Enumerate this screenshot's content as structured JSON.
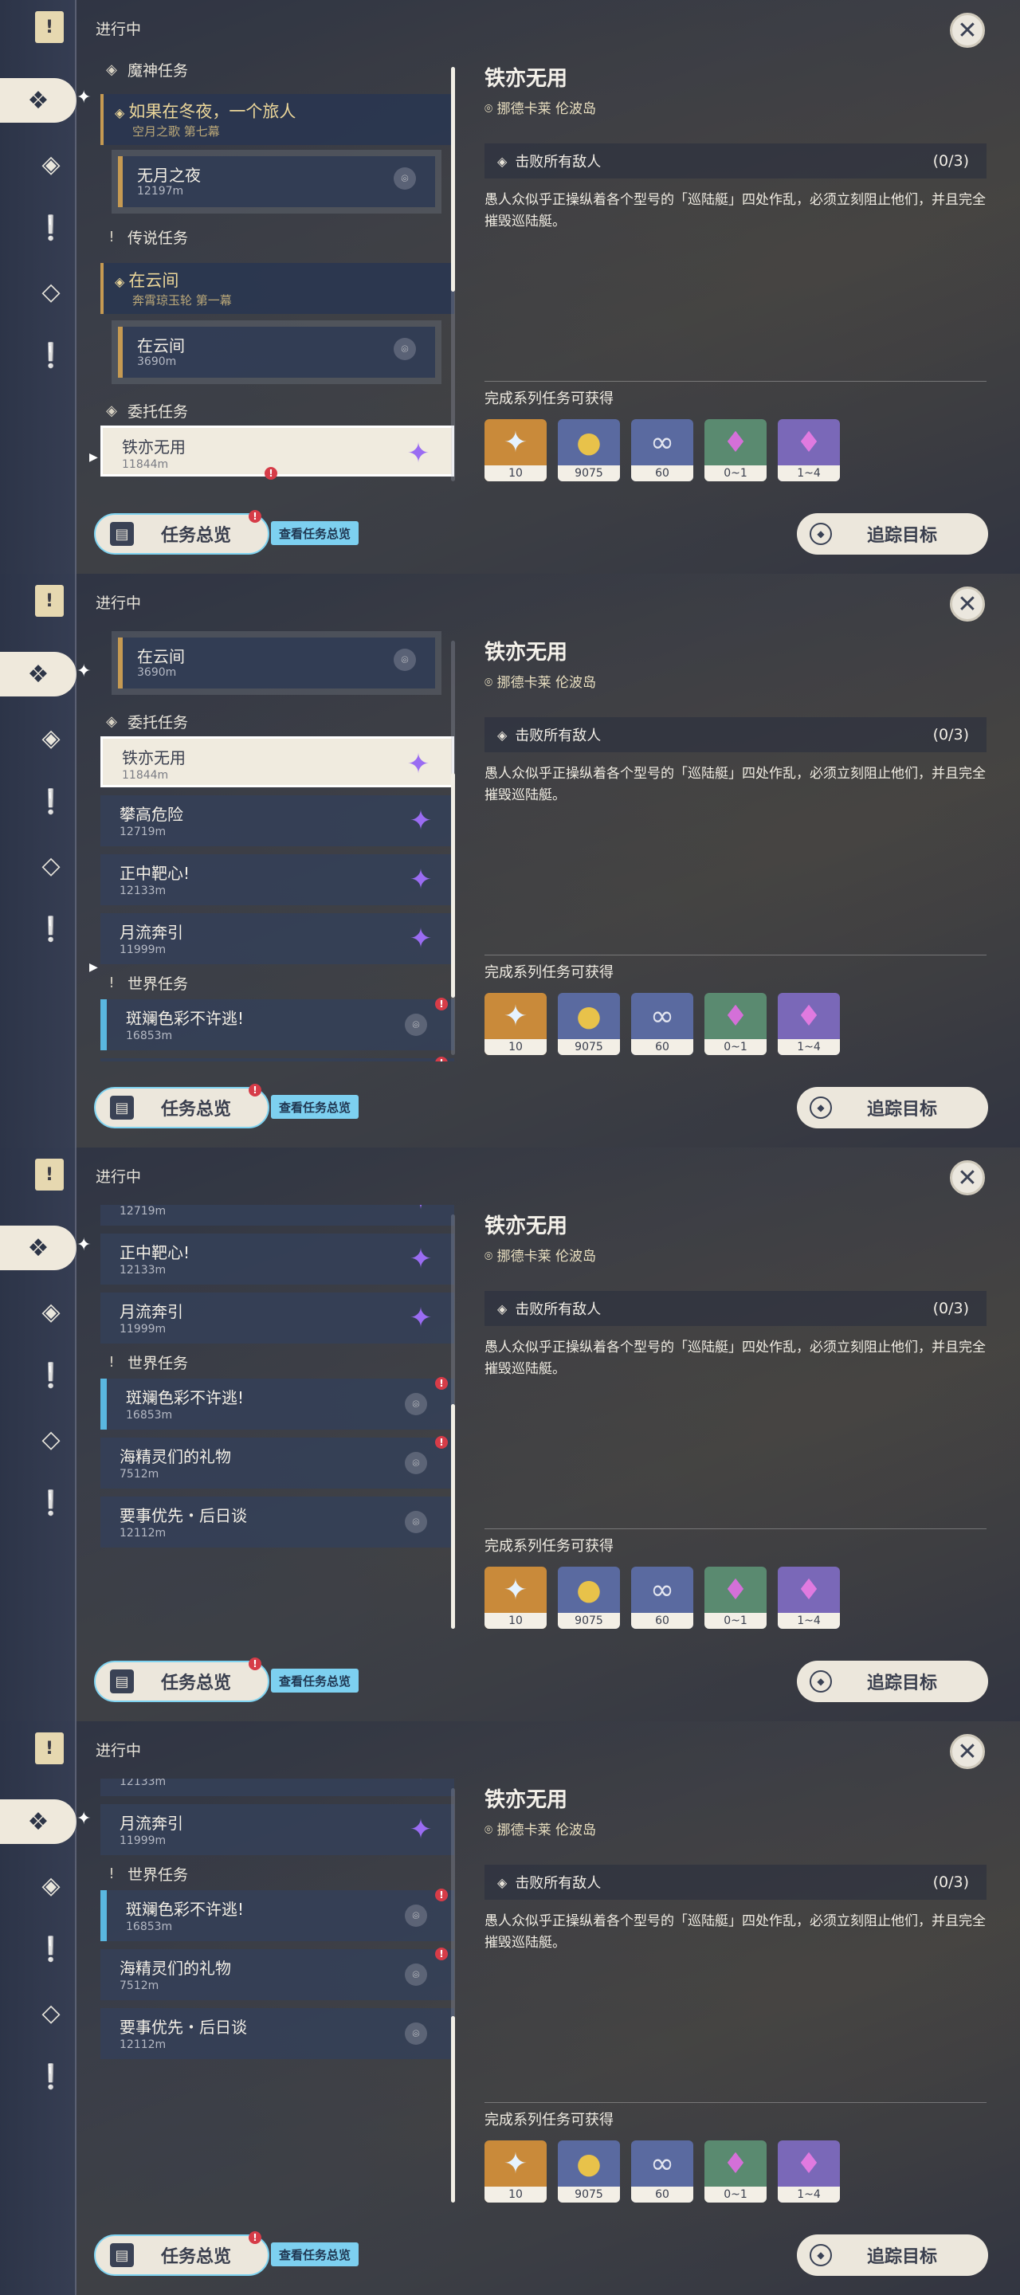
{
  "header": {
    "in_progress": "进行中"
  },
  "sidebar": {
    "icons": [
      "book-icon",
      "quest-diamond-icon",
      "archon-icon",
      "legend-icon",
      "commission-icon",
      "world-icon"
    ]
  },
  "list": {
    "cat_archon": "魔神任务",
    "archon_title": "如果在冬夜，一个旅人",
    "archon_sub": "空月之歌 第七幕",
    "moonless": {
      "title": "无月之夜",
      "dist": "12197m"
    },
    "cat_legend": "传说任务",
    "legend_title": "在云间",
    "legend_sub": "奔霄琼玉轮 第一幕",
    "cloud": {
      "title": "在云间",
      "dist": "3690m"
    },
    "cat_commission": "委托任务",
    "iron": {
      "title": "铁亦无用",
      "dist": "11844m"
    },
    "climb": {
      "title": "攀高危险",
      "dist": "12719m"
    },
    "bullseye": {
      "title": "正中靶心!",
      "dist": "12133m"
    },
    "moonflow": {
      "title": "月流奔引",
      "dist": "11999m"
    },
    "cat_world": "世界任务",
    "coral": {
      "title": "斑斓色彩不许逃!",
      "dist": "16853m"
    },
    "seasprite": {
      "title": "海精灵们的礼物",
      "dist": "7512m"
    },
    "priority": {
      "title": "要事优先・后日谈",
      "dist": "12112m"
    }
  },
  "overview": {
    "label": "任务总览",
    "tooltip": "查看任务总览"
  },
  "detail": {
    "title": "铁亦无用",
    "location": "挪德卡莱 伦波岛",
    "objective": "击败所有敌人",
    "progress": "(0/3)",
    "description": "愚人众似乎正操纵着各个型号的「巡陆艇」四处作乱，必须立刻阻止他们，并且完全摧毁巡陆艇。",
    "rewards_label": "完成系列任务可获得",
    "rewards": [
      {
        "icon": "adventure-exp-icon",
        "count": "10",
        "bg": "#c98a3a"
      },
      {
        "icon": "mora-icon",
        "count": "9075",
        "bg": "#5a6aa0"
      },
      {
        "icon": "friendship-exp-icon",
        "count": "60",
        "bg": "#5a6aa0"
      },
      {
        "icon": "crystal-green-icon",
        "count": "0~1",
        "bg": "#5a8a70"
      },
      {
        "icon": "crystal-purple-icon",
        "count": "1~4",
        "bg": "#7a68b8"
      }
    ]
  },
  "track": {
    "label": "追踪目标"
  },
  "colors": {
    "accent": "#7dd0f0",
    "badge": "#d63c48",
    "archon_gold": "#ecd79a",
    "commission_purple": "#9a6cf2"
  }
}
